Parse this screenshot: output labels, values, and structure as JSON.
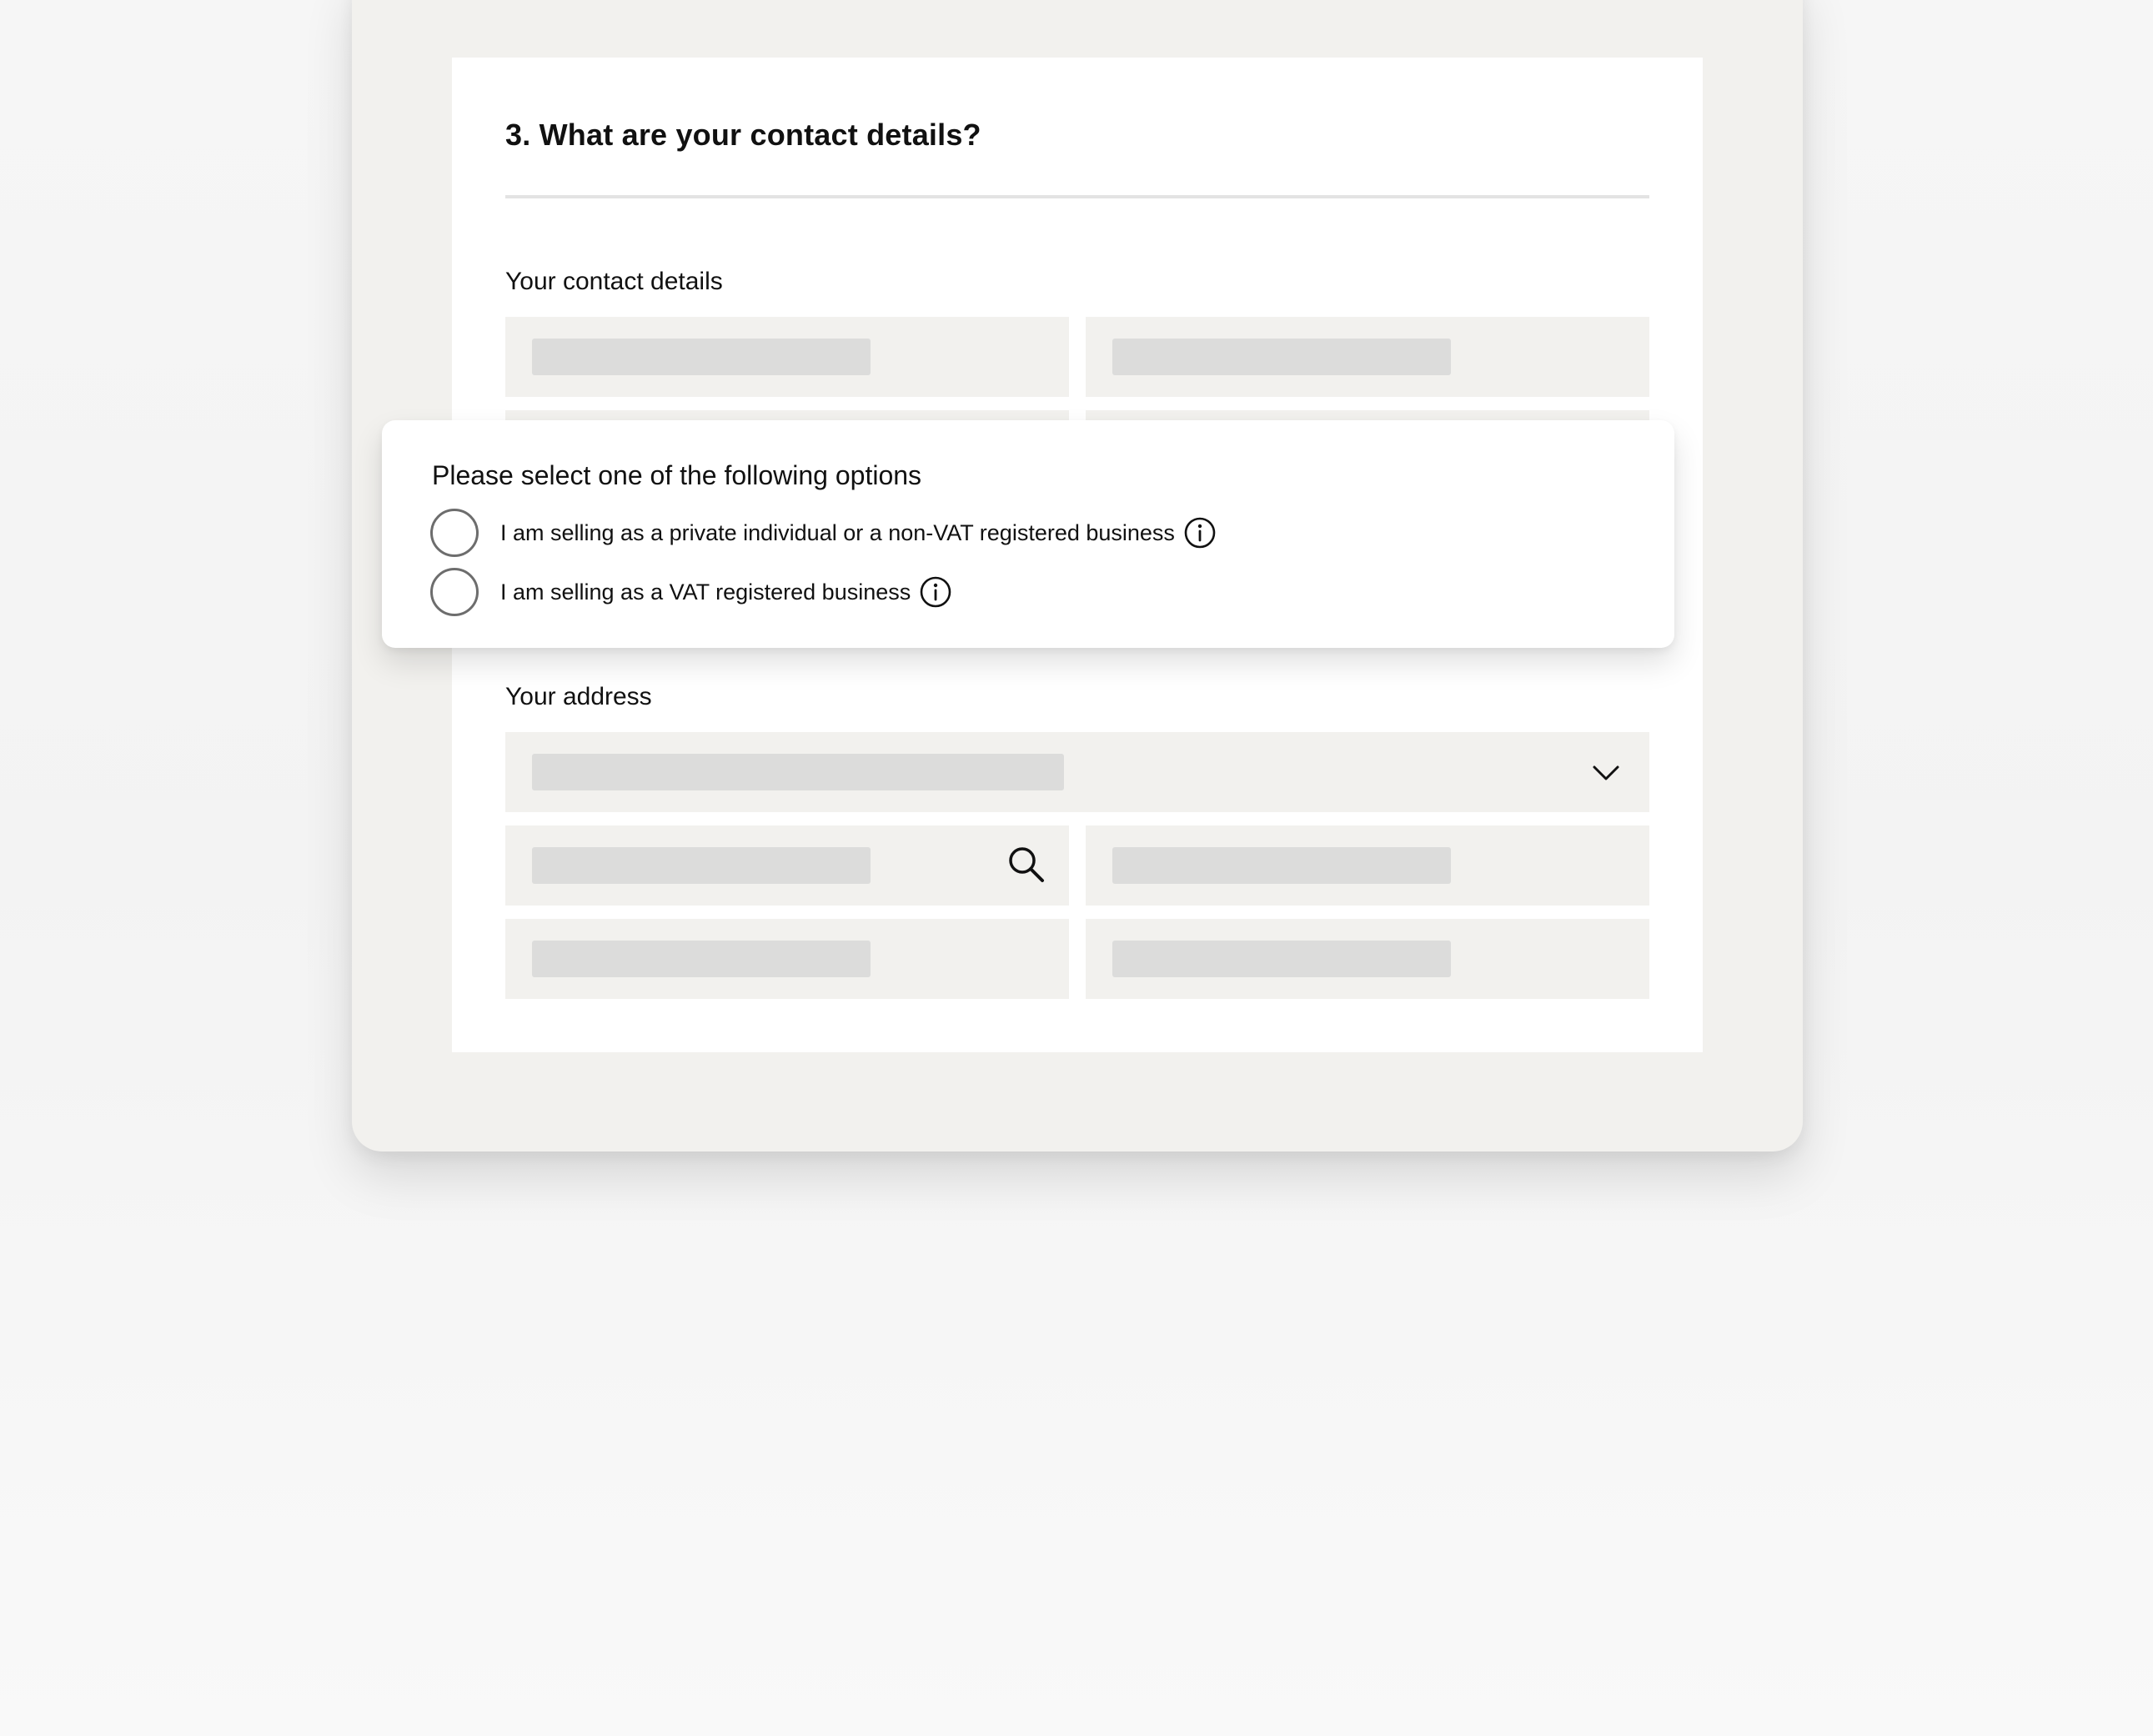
{
  "form": {
    "title": "3. What are your contact details?",
    "contact_section_label": "Your contact details",
    "address_section_label": "Your address"
  },
  "popover": {
    "title": "Please select one of the following options",
    "options": [
      {
        "label": "I am selling as a private individual or a non-VAT registered business",
        "selected": false,
        "icon": "info-icon"
      },
      {
        "label": "I am selling as a VAT registered business",
        "selected": false,
        "icon": "info-icon"
      }
    ]
  },
  "icons": {
    "dropdown": "chevron-down-icon",
    "search": "search-icon"
  },
  "colors": {
    "device_frame": "#f2f1ee",
    "card": "#ffffff",
    "field_background": "#f2f1ee",
    "placeholder_bar": "#dcdcdb",
    "radio_border": "#6d6d6d"
  }
}
